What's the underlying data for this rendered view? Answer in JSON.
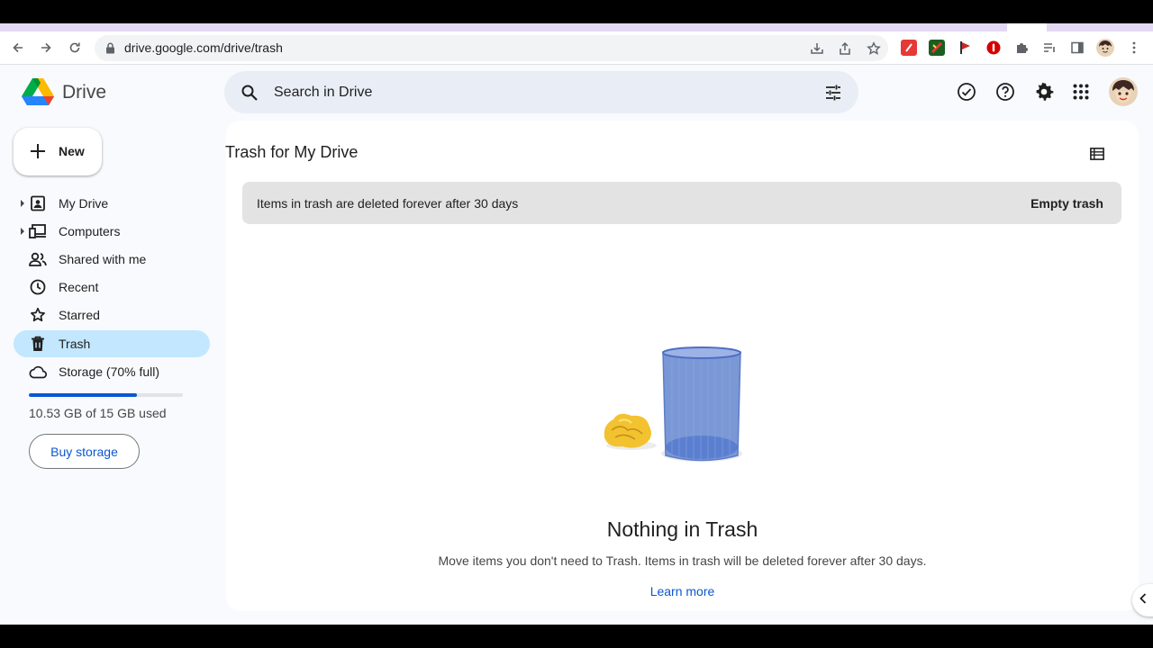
{
  "browser": {
    "url": "drive.google.com/drive/trash",
    "icons": [
      "back-arrow-icon",
      "forward-arrow-icon",
      "reload-icon",
      "lock-icon",
      "download-icon",
      "share-icon",
      "bookmark-star-icon",
      "extension-red-icon",
      "extension-green-red-icon",
      "extension-flag-icon",
      "extension-stop-icon",
      "extensions-puzzle-icon",
      "reading-list-icon",
      "side-panel-icon",
      "profile-avatar-icon",
      "chrome-menu-icon"
    ]
  },
  "app": {
    "name": "Drive",
    "search_placeholder": "Search in Drive",
    "header_icons": [
      "ready-for-offline-icon",
      "help-icon",
      "settings-icon",
      "apps-grid-icon"
    ]
  },
  "sidebar": {
    "new_label": "New",
    "items": [
      {
        "label": "My Drive",
        "icon": "my-drive-icon",
        "expandable": true,
        "active": false
      },
      {
        "label": "Computers",
        "icon": "computers-icon",
        "expandable": true,
        "active": false
      },
      {
        "label": "Shared with me",
        "icon": "shared-icon",
        "expandable": false,
        "active": false
      },
      {
        "label": "Recent",
        "icon": "clock-icon",
        "expandable": false,
        "active": false
      },
      {
        "label": "Starred",
        "icon": "star-icon",
        "expandable": false,
        "active": false
      },
      {
        "label": "Trash",
        "icon": "trash-icon",
        "expandable": false,
        "active": true
      },
      {
        "label": "Storage (70% full)",
        "icon": "cloud-icon",
        "expandable": false,
        "active": false
      }
    ],
    "storage": {
      "fraction_used": 0.7,
      "used_text": "10.53 GB of 15 GB used",
      "buy_label": "Buy storage"
    }
  },
  "main": {
    "title": "Trash for My Drive",
    "banner": {
      "text": "Items in trash are deleted forever after 30 days",
      "action": "Empty trash"
    },
    "empty_state": {
      "title": "Nothing in Trash",
      "description": "Move items you don't need to Trash. Items in trash will be deleted forever after 30 days.",
      "link": "Learn more"
    }
  },
  "colors": {
    "accent": "#0b57d0",
    "active_nav": "#c2e7ff",
    "app_background": "#f8fafd",
    "search_background": "#e9eef6",
    "banner_background": "#e3e3e3"
  }
}
